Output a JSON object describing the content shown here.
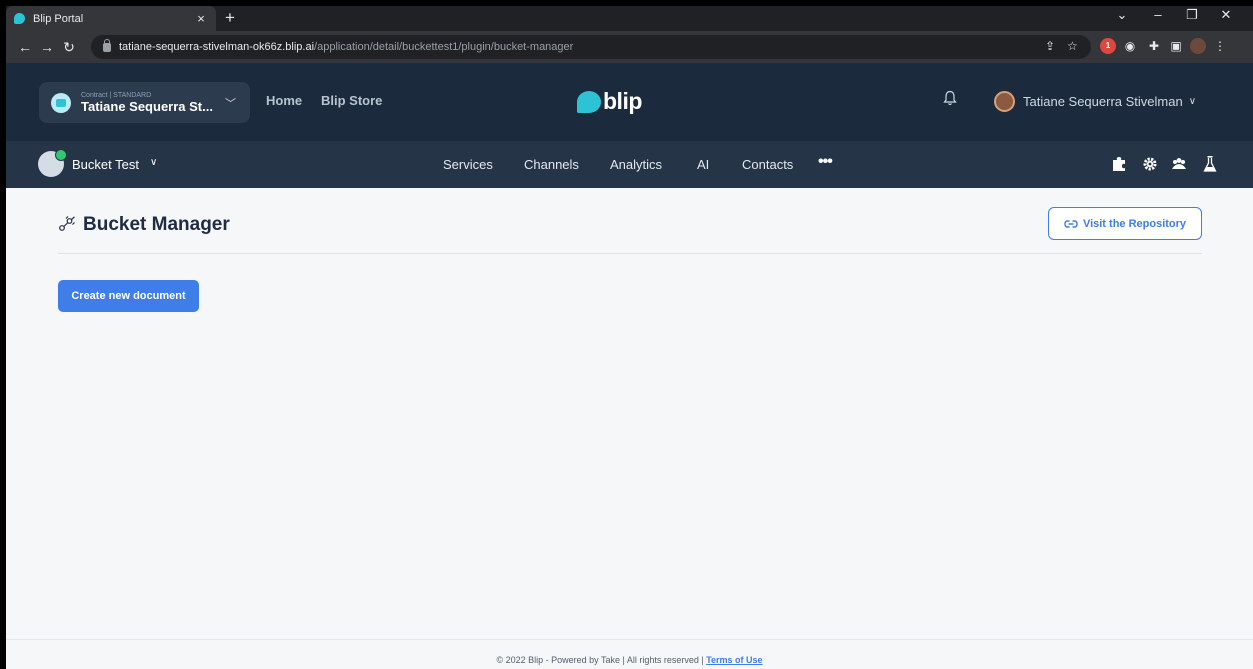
{
  "browser": {
    "tab_title": "Blip Portal",
    "tab_close": "×",
    "new_tab": "+",
    "url_host": "tatiane-sequerra-stivelman-ok66z.blip.ai",
    "url_path": "/application/detail/buckettest1/plugin/bucket-manager",
    "ext_badge": "1"
  },
  "header": {
    "contract_label": "Contract | STANDARD",
    "contract_name": "Tatiane Sequerra St...",
    "nav": [
      "Home",
      "Blip Store"
    ],
    "logo_text": "blip",
    "user_name": "Tatiane Sequerra Stivelman"
  },
  "bot_nav": {
    "bot_name": "Bucket Test",
    "items": [
      "Services",
      "Channels",
      "Analytics",
      "AI",
      "Contacts"
    ],
    "more": "•••"
  },
  "main": {
    "title": "Bucket Manager",
    "repo_button": "Visit the Repository",
    "create_button": "Create new document"
  },
  "footer": {
    "text": "© 2022 Blip - Powered by Take | All rights reserved | ",
    "terms_link": "Terms of Use"
  },
  "colors": {
    "header_dark": "#1c2a3d",
    "header_secondary": "#253447",
    "accent_blue": "#3f7de8",
    "brand_cyan": "#2cc3d5"
  }
}
